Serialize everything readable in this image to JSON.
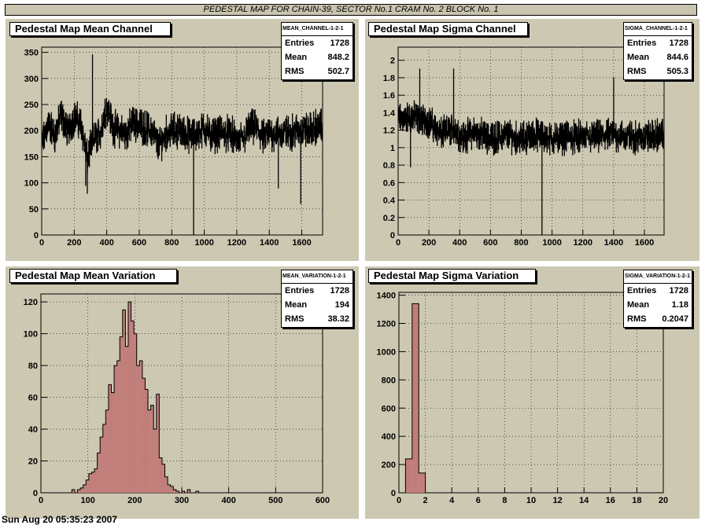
{
  "page": {
    "title": "PEDESTAL MAP FOR CHAIN-39, SECTOR No.1 CRAM No. 2 BLOCK No. 1",
    "footer": "Sun Aug 20 05:35:23 2007"
  },
  "colors": {
    "pad_bg": "#cdc8b2",
    "hist_fill": "#c17d79",
    "line": "#000000"
  },
  "panels": [
    {
      "title": "Pedestal Map Mean Channel",
      "stats": {
        "name": "MEAN_CHANNEL-1-2-1",
        "entries_label": "Entries",
        "entries": "1728",
        "mean_label": "Mean",
        "mean": "848.2",
        "rms_label": "RMS",
        "rms": "502.7"
      },
      "chart_data": {
        "type": "line",
        "x_range": [
          0,
          1728
        ],
        "ylim": [
          0,
          360
        ],
        "xticks": [
          0,
          200,
          400,
          600,
          800,
          1000,
          1200,
          1400,
          1600
        ],
        "yticks": [
          0,
          50,
          100,
          150,
          200,
          250,
          300,
          350
        ],
        "profile": [
          [
            0,
            170
          ],
          [
            40,
            215
          ],
          [
            80,
            190
          ],
          [
            120,
            230
          ],
          [
            160,
            200
          ],
          [
            200,
            225
          ],
          [
            240,
            215
          ],
          [
            280,
            145
          ],
          [
            320,
            185
          ],
          [
            360,
            195
          ],
          [
            400,
            250
          ],
          [
            440,
            205
          ],
          [
            480,
            200
          ],
          [
            520,
            195
          ],
          [
            560,
            215
          ],
          [
            600,
            210
          ],
          [
            640,
            205
          ],
          [
            680,
            200
          ],
          [
            720,
            170
          ],
          [
            760,
            195
          ],
          [
            800,
            200
          ],
          [
            840,
            200
          ],
          [
            880,
            195
          ],
          [
            920,
            190
          ],
          [
            960,
            195
          ],
          [
            1000,
            205
          ],
          [
            1040,
            190
          ],
          [
            1080,
            195
          ],
          [
            1120,
            195
          ],
          [
            1160,
            195
          ],
          [
            1200,
            180
          ],
          [
            1240,
            185
          ],
          [
            1280,
            205
          ],
          [
            1320,
            205
          ],
          [
            1360,
            185
          ],
          [
            1400,
            195
          ],
          [
            1440,
            195
          ],
          [
            1480,
            195
          ],
          [
            1520,
            195
          ],
          [
            1560,
            200
          ],
          [
            1600,
            200
          ],
          [
            1640,
            200
          ],
          [
            1680,
            205
          ],
          [
            1728,
            210
          ]
        ],
        "noise": 40,
        "spikes": [
          [
            934,
            0
          ],
          [
            270,
            95
          ],
          [
            280,
            80
          ],
          [
            312,
            345
          ],
          [
            1593,
            60
          ],
          [
            1455,
            90
          ]
        ]
      }
    },
    {
      "title": "Pedestal Map Sigma Channel",
      "stats": {
        "name": "SIGMA_CHANNEL-1-2-1",
        "entries_label": "Entries",
        "entries": "1728",
        "mean_label": "Mean",
        "mean": "844.6",
        "rms_label": "RMS",
        "rms": "505.3"
      },
      "chart_data": {
        "type": "line",
        "x_range": [
          0,
          1728
        ],
        "ylim": [
          0,
          2.15
        ],
        "xticks": [
          0,
          200,
          400,
          600,
          800,
          1000,
          1200,
          1400,
          1600
        ],
        "yticks": [
          0,
          0.2,
          0.4,
          0.6,
          0.8,
          1,
          1.2,
          1.4,
          1.6,
          1.8,
          2
        ],
        "profile": [
          [
            0,
            1.32
          ],
          [
            100,
            1.35
          ],
          [
            200,
            1.3
          ],
          [
            280,
            1.15
          ],
          [
            360,
            1.22
          ],
          [
            420,
            1.12
          ],
          [
            500,
            1.18
          ],
          [
            600,
            1.1
          ],
          [
            700,
            1.15
          ],
          [
            800,
            1.1
          ],
          [
            900,
            1.15
          ],
          [
            1000,
            1.1
          ],
          [
            1100,
            1.12
          ],
          [
            1200,
            1.12
          ],
          [
            1300,
            1.12
          ],
          [
            1400,
            1.15
          ],
          [
            1500,
            1.12
          ],
          [
            1600,
            1.12
          ],
          [
            1728,
            1.15
          ]
        ],
        "noise": 0.22,
        "spikes": [
          [
            934,
            0
          ],
          [
            140,
            1.9
          ],
          [
            360,
            1.9
          ],
          [
            1400,
            1.8
          ],
          [
            80,
            0.78
          ]
        ]
      }
    },
    {
      "title": "Pedestal Map Mean Variation",
      "stats": {
        "name": "MEAN_VARIATION-1-2-1",
        "entries_label": "Entries",
        "entries": "1728",
        "mean_label": "Mean",
        "mean": "194",
        "rms_label": "RMS",
        "rms": "38.32"
      },
      "chart_data": {
        "type": "bar",
        "bin_width": 6,
        "x_range": [
          0,
          600
        ],
        "ylim": [
          0,
          125
        ],
        "xticks": [
          0,
          100,
          200,
          300,
          400,
          500,
          600
        ],
        "yticks": [
          0,
          20,
          40,
          60,
          80,
          100,
          120
        ],
        "bins_start": 66,
        "values": [
          2,
          0,
          2,
          3,
          5,
          8,
          12,
          13,
          15,
          25,
          35,
          43,
          52,
          68,
          63,
          80,
          83,
          98,
          115,
          92,
          120,
          108,
          100,
          80,
          83,
          72,
          65,
          52,
          55,
          40,
          62,
          22,
          18,
          10,
          5,
          4,
          2,
          1,
          0,
          1,
          0,
          2,
          0,
          0,
          1
        ]
      }
    },
    {
      "title": "Pedestal Map Sigma Variation",
      "stats": {
        "name": "SIGMA_VARIATION-1-2-1",
        "entries_label": "Entries",
        "entries": "1728",
        "mean_label": "Mean",
        "mean": "1.18",
        "rms_label": "RMS",
        "rms": "0.2047"
      },
      "chart_data": {
        "type": "bar",
        "bin_width": 0.5,
        "x_range": [
          0,
          20
        ],
        "ylim": [
          0,
          1420
        ],
        "xticks": [
          0,
          2,
          4,
          6,
          8,
          10,
          12,
          14,
          16,
          18,
          20
        ],
        "yticks": [
          0,
          200,
          400,
          600,
          800,
          1000,
          1200,
          1400
        ],
        "bins_start": 0.5,
        "values": [
          240,
          1340,
          140
        ]
      }
    }
  ]
}
